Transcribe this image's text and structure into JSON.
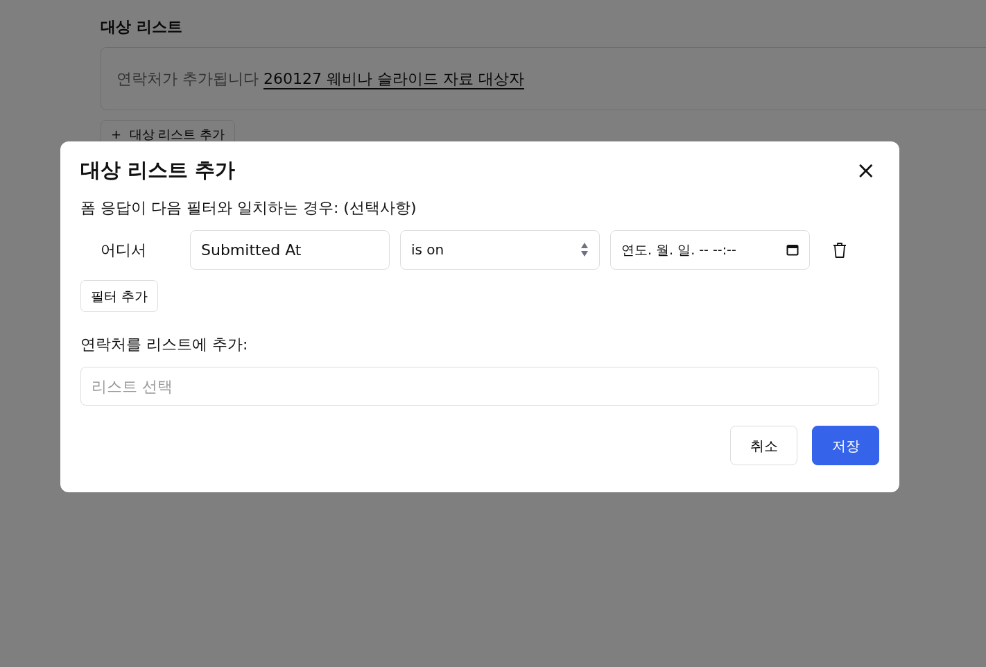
{
  "page": {
    "section_title": "대상 리스트",
    "list_note": {
      "prefix": "연락처가 추가됩니다",
      "link": "260127 웨비나 슬라이드 자료 대상자"
    },
    "add_button": {
      "icon": "+",
      "label": "대상 리스트 추가"
    }
  },
  "modal": {
    "title": "대상 리스트 추가",
    "close": "×",
    "filter_heading": "폼 응답이 다음 필터와 일치하는 경우: (선택사항)",
    "filters": [
      {
        "prefix": "어디서",
        "field": "Submitted At",
        "operator": "is on",
        "date_placeholder": "연도. 월. 일. -- --:--"
      }
    ],
    "add_filter_button": "필터 추가",
    "list_heading": "연락처를 리스트에 추가:",
    "list_select": {
      "placeholder": "리스트 선택"
    },
    "buttons": [
      {
        "label": "취소",
        "kind": "secondary"
      },
      {
        "label": "저장",
        "kind": "primary"
      }
    ]
  }
}
